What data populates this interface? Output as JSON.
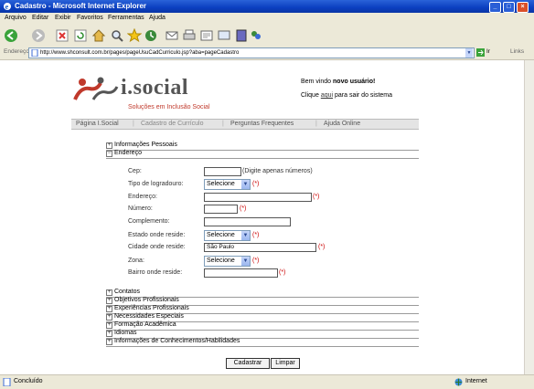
{
  "window": {
    "title": "Cadastro - Microsoft Internet Explorer"
  },
  "menu": [
    "Arquivo",
    "Editar",
    "Exibir",
    "Favoritos",
    "Ferramentas",
    "Ajuda"
  ],
  "address": {
    "label": "Endereço",
    "url": "http://www.shconsult.com.br/pages/pageUsuCadCurriculo.jsp?aba=pageCadastro",
    "go": "Ir",
    "links": "Links"
  },
  "page": {
    "brand": "i.social",
    "slogan": "Soluções em Inclusão Social",
    "welcome_prefix": "Bem vindo",
    "welcome_user": "novo usuário!",
    "exit_prefix": "Clique",
    "exit_link": "aqui",
    "exit_suffix": "para sair do sistema"
  },
  "nav": [
    "Página I.Social",
    "Cadastro de Currículo",
    "Perguntas Frequentes",
    "Ajuda Online"
  ],
  "sections_top": [
    "Informações Pessoais",
    "Endereço"
  ],
  "form": {
    "cep": {
      "label": "Cep:",
      "value": "",
      "hint": "(Digite apenas números)"
    },
    "tipo_logradouro": {
      "label": "Tipo de logradouro:",
      "value": "Selecione"
    },
    "endereco": {
      "label": "Endereço:",
      "value": ""
    },
    "numero": {
      "label": "Número:",
      "value": ""
    },
    "complemento": {
      "label": "Complemento:",
      "value": ""
    },
    "estado": {
      "label": "Estado onde reside:",
      "value": "Selecione"
    },
    "cidade": {
      "label": "Cidade onde reside:",
      "value": "São Paulo"
    },
    "zona": {
      "label": "Zona:",
      "value": "Selecione"
    },
    "bairro": {
      "label": "Bairro onde reside:",
      "value": ""
    },
    "required_mark": "(*)"
  },
  "sections_bottom": [
    "Contatos",
    "Objetivos Profissionais",
    "Experiências Profissionais",
    "Necessidades Especiais",
    "Formação Acadêmica",
    "Idiomas",
    "Informações de Conhecimentos/Habilidades"
  ],
  "buttons": {
    "cadastrar": "Cadastrar",
    "limpar": "Limpar"
  },
  "status": {
    "left": "Concluído",
    "right": "Internet"
  }
}
